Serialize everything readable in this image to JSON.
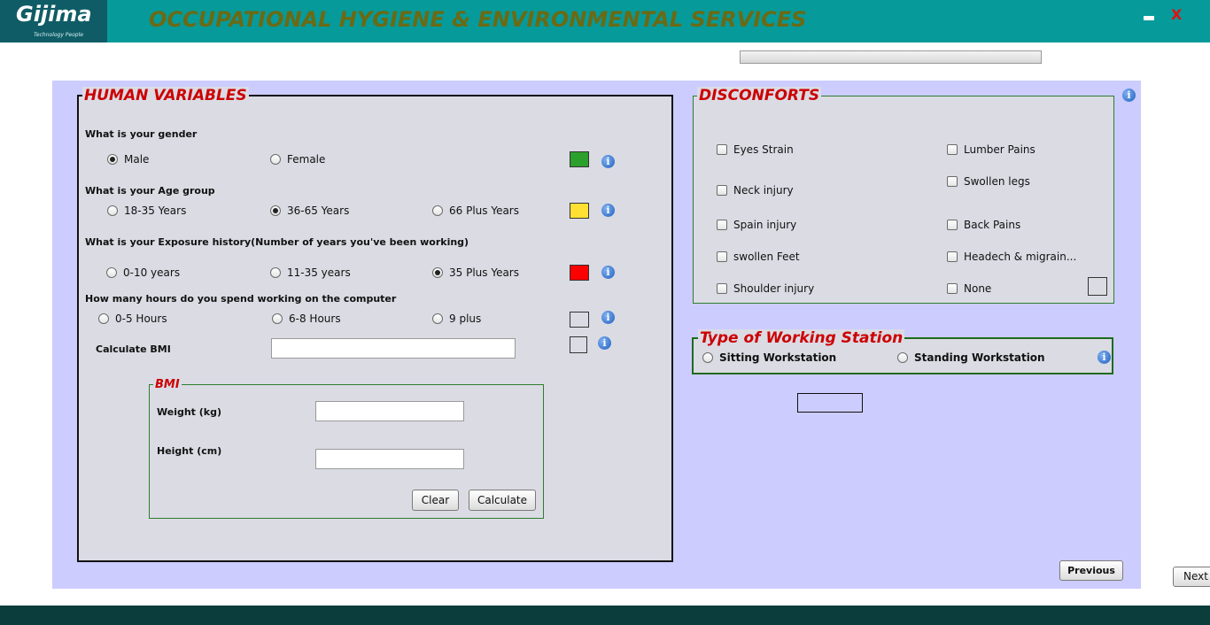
{
  "header": {
    "logo_text": "Gijima",
    "logo_tagline": "Technology People",
    "title": "OCCUPATIONAL HYGIENE & ENVIRONMENTAL SERVICES",
    "minimize_icon": "minimize-icon",
    "close_label": "X",
    "close_color": "#e01010"
  },
  "progress": {
    "value": 0
  },
  "human": {
    "title": "HUMAN VARIABLES",
    "gender": {
      "question": "What is your gender",
      "options": [
        "Male",
        "Female"
      ],
      "selected": "Male",
      "indicator_color": "#2ca02c"
    },
    "age": {
      "question": "What is your Age group",
      "options": [
        "18-35 Years",
        "36-65 Years",
        "66 Plus Years"
      ],
      "selected": "36-65 Years",
      "indicator_color": "#ffe033"
    },
    "exposure": {
      "question": "What is your Exposure history(Number of years you've been working)",
      "options": [
        "0-10 years",
        "11-35 years",
        "35 Plus Years"
      ],
      "selected": "35 Plus Years",
      "indicator_color": "#ff0000"
    },
    "hours": {
      "question": "How many hours do you spend working on the computer",
      "options": [
        "0-5 Hours",
        "6-8 Hours",
        "9 plus"
      ],
      "selected": null
    },
    "bmi_calc": {
      "label": "Calculate BMI",
      "value": ""
    },
    "bmi": {
      "title": "BMI",
      "weight_label": "Weight  (kg)",
      "weight_value": "",
      "height_label": "Height   (cm)",
      "height_value": "",
      "clear_label": "Clear",
      "calculate_label": "Calculate"
    }
  },
  "discomforts": {
    "title": "DISCONFORTS",
    "left": [
      "Eyes Strain",
      "Neck injury",
      "Spain injury",
      "swollen Feet",
      "Shoulder injury"
    ],
    "right": [
      "Lumber Pains",
      "Swollen legs",
      "Back Pains",
      "Headech & migrain...",
      "None"
    ]
  },
  "station": {
    "title": "Type of Working Station",
    "options": [
      "Sitting Workstation",
      "Standing Workstation"
    ],
    "selected": null
  },
  "nav": {
    "previous_label": "Previous",
    "next_label": "Next"
  },
  "colors": {
    "header_bg": "#069a9a",
    "panel_bg": "#ccccff",
    "legend_red": "#cc0000",
    "footer_bg": "#0a3d3c"
  }
}
